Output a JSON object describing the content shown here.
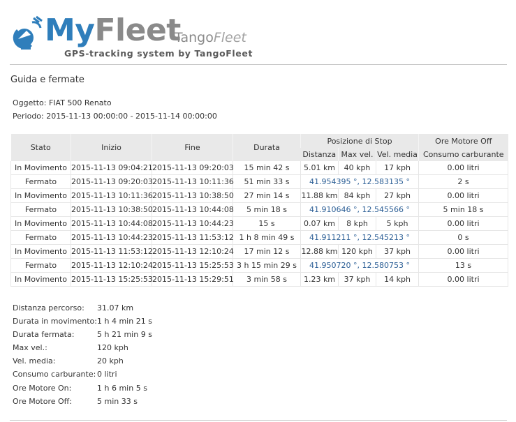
{
  "header": {
    "brand_my": "My",
    "brand_fleet": "Fleet",
    "tango": "Tango",
    "tango_fleet": "Fleet",
    "tagline": "GPS-tracking system by TangoFleet",
    "colors": {
      "brand_blue": "#2f7ebb",
      "brand_gray": "#8a8a8a"
    },
    "logo_icon": "satellite-dish-icon"
  },
  "page_title": "Guida e fermate",
  "meta": {
    "object_label": "Oggetto:",
    "object_value": "FIAT 500 Renato",
    "period_label": "Periodo:",
    "period_value": "2015-11-13 00:00:00 - 2015-11-14 00:00:00"
  },
  "table": {
    "headers": {
      "stato": "Stato",
      "inizio": "Inizio",
      "fine": "Fine",
      "durata": "Durata",
      "posizione_di_stop": "Posizione di Stop",
      "ore_motore_off": "Ore Motore Off",
      "distanza": "Distanza",
      "max_vel": "Max vel.",
      "vel_media": "Vel. media",
      "consumo_carburante": "Consumo carburante"
    },
    "rows": [
      {
        "type": "move",
        "stato": "In Movimento",
        "inizio": "2015-11-13 09:04:21",
        "fine": "2015-11-13 09:20:03",
        "durata": "15 min 42 s",
        "distanza": "5.01 km",
        "max_vel": "40 kph",
        "vel_media": "17 kph",
        "last": "0.00 litri"
      },
      {
        "type": "stop",
        "stato": "Fermato",
        "inizio": "2015-11-13 09:20:03",
        "fine": "2015-11-13 10:11:36",
        "durata": "51 min 33 s",
        "coord": "41.954395 °, 12.583135 °",
        "last": "2 s"
      },
      {
        "type": "move",
        "stato": "In Movimento",
        "inizio": "2015-11-13 10:11:36",
        "fine": "2015-11-13 10:38:50",
        "durata": "27 min 14 s",
        "distanza": "11.88 km",
        "max_vel": "84 kph",
        "vel_media": "27 kph",
        "last": "0.00 litri"
      },
      {
        "type": "stop",
        "stato": "Fermato",
        "inizio": "2015-11-13 10:38:50",
        "fine": "2015-11-13 10:44:08",
        "durata": "5 min 18 s",
        "coord": "41.910646 °, 12.545566 °",
        "last": "5 min 18 s"
      },
      {
        "type": "move",
        "stato": "In Movimento",
        "inizio": "2015-11-13 10:44:08",
        "fine": "2015-11-13 10:44:23",
        "durata": "15 s",
        "distanza": "0.07 km",
        "max_vel": "8 kph",
        "vel_media": "5 kph",
        "last": "0.00 litri"
      },
      {
        "type": "stop",
        "stato": "Fermato",
        "inizio": "2015-11-13 10:44:23",
        "fine": "2015-11-13 11:53:12",
        "durata": "1 h 8 min 49 s",
        "coord": "41.911211 °, 12.545213 °",
        "last": "0 s"
      },
      {
        "type": "move",
        "stato": "In Movimento",
        "inizio": "2015-11-13 11:53:12",
        "fine": "2015-11-13 12:10:24",
        "durata": "17 min 12 s",
        "distanza": "12.88 km",
        "max_vel": "120 kph",
        "vel_media": "37 kph",
        "last": "0.00 litri"
      },
      {
        "type": "stop",
        "stato": "Fermato",
        "inizio": "2015-11-13 12:10:24",
        "fine": "2015-11-13 15:25:53",
        "durata": "3 h 15 min 29 s",
        "coord": "41.950720 °, 12.580753 °",
        "last": "13 s"
      },
      {
        "type": "move",
        "stato": "In Movimento",
        "inizio": "2015-11-13 15:25:53",
        "fine": "2015-11-13 15:29:51",
        "durata": "3 min 58 s",
        "distanza": "1.23 km",
        "max_vel": "37 kph",
        "vel_media": "14 kph",
        "last": "0.00 litri"
      }
    ]
  },
  "summary": [
    {
      "label": "Distanza percorso:",
      "value": "31.07 km"
    },
    {
      "label": "Durata in movimento:",
      "value": "1 h 4 min 21 s"
    },
    {
      "label": "Durata fermata:",
      "value": "5 h 21 min 9 s"
    },
    {
      "label": "Max vel.:",
      "value": "120 kph"
    },
    {
      "label": "Vel. media:",
      "value": "20 kph"
    },
    {
      "label": "Consumo carburante:",
      "value": "0 litri"
    },
    {
      "label": "Ore Motore On:",
      "value": "1 h 6 min 5 s"
    },
    {
      "label": "Ore Motore Off:",
      "value": "5 min 33 s"
    }
  ]
}
